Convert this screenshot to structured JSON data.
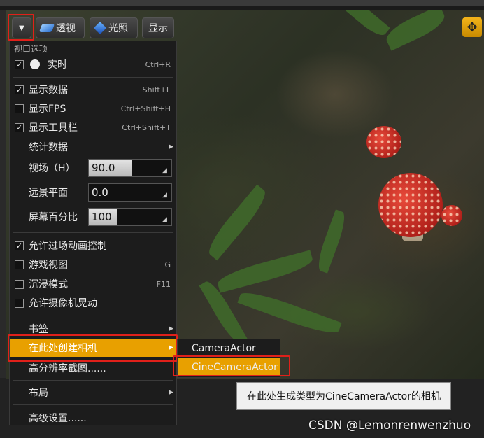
{
  "toolbar": {
    "menu_button_icon": "chevron-down-icon",
    "perspective_label": "透视",
    "lit_label": "光照",
    "show_label": "显示",
    "maximize_icon": "move-arrows-icon"
  },
  "menu": {
    "section_title": "视口选项",
    "items": [
      {
        "label": "实时",
        "shortcut": "Ctrl+R",
        "checked": true
      },
      {
        "label": "显示数据",
        "shortcut": "Shift+L",
        "checked": true
      },
      {
        "label": "显示FPS",
        "shortcut": "Ctrl+Shift+H",
        "checked": false
      },
      {
        "label": "显示工具栏",
        "shortcut": "Ctrl+Shift+T",
        "checked": true
      },
      {
        "label": "统计数据"
      }
    ],
    "fov_label": "视场（H）",
    "fov_value": "90.0",
    "fov_fill_fraction": 0.5,
    "far_plane_label": "远景平面",
    "far_plane_value": "0.0",
    "screen_pct_label": "屏幕百分比",
    "screen_pct_value": "100",
    "screen_pct_fill_fraction": 0.33,
    "toggles": [
      {
        "label": "允许过场动画控制",
        "shortcut": "",
        "checked": true
      },
      {
        "label": "游戏视图",
        "shortcut": "G",
        "checked": false
      },
      {
        "label": "沉浸模式",
        "shortcut": "F11",
        "checked": false
      },
      {
        "label": "允许摄像机晃动",
        "shortcut": "",
        "checked": false
      }
    ],
    "bookmarks_label": "书签",
    "create_camera_label": "在此处创建相机",
    "high_res_label": "高分辨率截图......",
    "layout_label": "布局",
    "advanced_label": "高级设置......"
  },
  "submenu": {
    "items": [
      "CameraActor",
      "CineCameraActor"
    ]
  },
  "tooltip": "在此处生成类型为CineCameraActor的相机",
  "watermark": "CSDN @Lemonrenwenzhuo",
  "colors": {
    "highlight": "#e8a000",
    "annotation": "#e0201a"
  }
}
